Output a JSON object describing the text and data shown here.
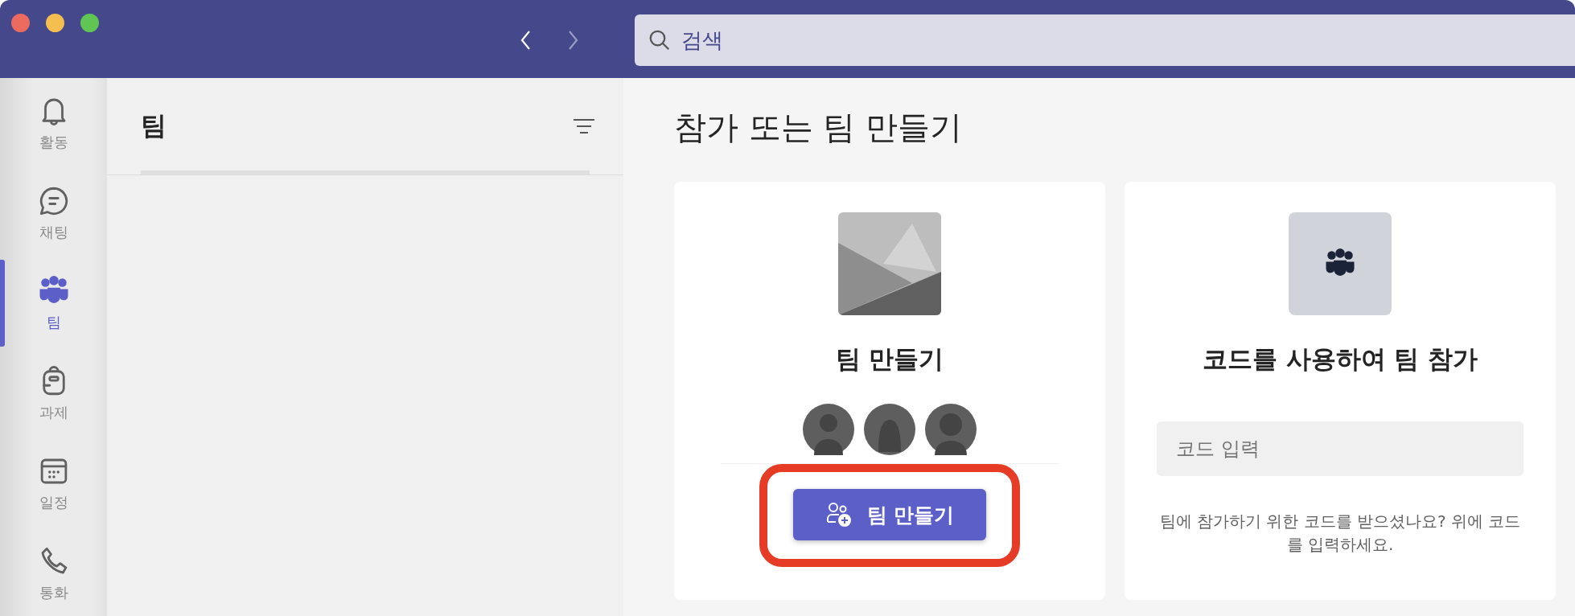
{
  "title_bar": {
    "nav": [
      {
        "kind": "back",
        "disabled": false
      },
      {
        "kind": "forward",
        "disabled": true
      }
    ],
    "search": {
      "placeholder": "검색"
    }
  },
  "rail": {
    "items": [
      {
        "kind": "bell",
        "label": "활동",
        "selected": false
      },
      {
        "kind": "chat",
        "label": "채팅",
        "selected": false
      },
      {
        "kind": "teams",
        "label": "팀",
        "selected": true
      },
      {
        "kind": "backpack",
        "label": "과제",
        "selected": false
      },
      {
        "kind": "calendar",
        "label": "일정",
        "selected": false
      },
      {
        "kind": "phone",
        "label": "통화",
        "selected": false
      }
    ]
  },
  "teams_panel": {
    "title": "팀"
  },
  "main": {
    "title": "참가 또는 팀 만들기",
    "create_card": {
      "kind": "picture",
      "title": "팀 만들기",
      "button": {
        "label": "팀 만들기",
        "highlighted": true
      }
    },
    "join_card": {
      "title": "코드를 사용하여 팀 참가",
      "code_field": {
        "placeholder": "코드 입력"
      },
      "help": "팀에 참가하기 위한 코드를 받으셨나요? 위에 코드를 입력하세요."
    }
  }
}
